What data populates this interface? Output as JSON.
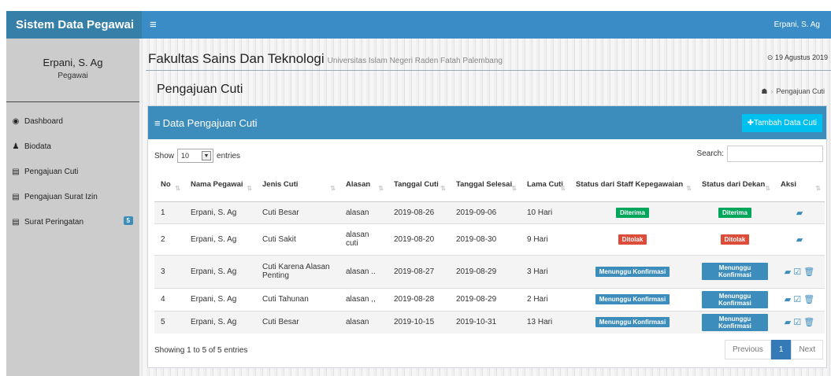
{
  "app": {
    "brand": "Sistem Data Pegawai",
    "user": "Erpani, S. Ag"
  },
  "sidebar": {
    "name": "Erpani, S. Ag",
    "role": "Pegawai",
    "items": [
      {
        "label": "Dashboard",
        "icon": "dashboard-icon"
      },
      {
        "label": "Biodata",
        "icon": "user-icon"
      },
      {
        "label": "Pengajuan Cuti",
        "icon": "card-icon"
      },
      {
        "label": "Pengajuan Surat Izin",
        "icon": "card-icon"
      },
      {
        "label": "Surat Peringatan",
        "icon": "card-icon",
        "badge": "5"
      }
    ]
  },
  "header": {
    "faculty": "Fakultas Sains Dan Teknologi",
    "university": "Universitas Islam Negeri Raden Fatah Palembang",
    "date": "⊙ 19 Agustus 2019"
  },
  "page": {
    "title": "Pengajuan Cuti",
    "breadcrumb_current": "Pengajuan Cuti"
  },
  "box": {
    "title": "Data Pengajuan Cuti",
    "add_button": "Tambah Data Cuti",
    "show_label": "Show",
    "entries_label": "entries",
    "page_length": "10",
    "search_label": "Search:",
    "search_value": ""
  },
  "table": {
    "columns": [
      "No",
      "Nama Pegawai",
      "Jenis Cuti",
      "Alasan",
      "Tanggal Cuti",
      "Tanggal Selesai",
      "Lama Cuti",
      "Status dari Staff Kepegawaian",
      "Status dari Dekan",
      "Aksi"
    ],
    "rows": [
      {
        "no": "1",
        "nama": "Erpani, S. Ag",
        "jenis": "Cuti Besar",
        "alasan": "alasan",
        "tgl": "2019-08-26",
        "selesai": "2019-09-06",
        "lama": "10 Hari",
        "staff": "Diterima",
        "staff_color": "g",
        "dekan": "Diterima",
        "dekan_color": "g",
        "aksi": "▰"
      },
      {
        "no": "2",
        "nama": "Erpani, S. Ag",
        "jenis": "Cuti Sakit",
        "alasan": "alasan cuti",
        "tgl": "2019-08-20",
        "selesai": "2019-08-30",
        "lama": "9 Hari",
        "staff": "Ditolak",
        "staff_color": "r",
        "dekan": "Ditolak",
        "dekan_color": "r",
        "aksi": "▰"
      },
      {
        "no": "3",
        "nama": "Erpani, S. Ag",
        "jenis": "Cuti Karena Alasan Penting",
        "alasan": "alasan ..",
        "tgl": "2019-08-27",
        "selesai": "2019-08-29",
        "lama": "3 Hari",
        "staff": "Menunggu Konfirmasi",
        "staff_color": "b",
        "dekan": "Menunggu Konfirmasi",
        "dekan_color": "b",
        "aksi": "▰ ☑ 🗑"
      },
      {
        "no": "4",
        "nama": "Erpani, S. Ag",
        "jenis": "Cuti Tahunan",
        "alasan": "alasan ,,",
        "tgl": "2019-08-28",
        "selesai": "2019-08-29",
        "lama": "2 Hari",
        "staff": "Menunggu Konfirmasi",
        "staff_color": "b",
        "dekan": "Menunggu Konfirmasi",
        "dekan_color": "b",
        "aksi": "▰ ☑ 🗑"
      },
      {
        "no": "5",
        "nama": "Erpani, S. Ag",
        "jenis": "Cuti Besar",
        "alasan": "alasan",
        "tgl": "2019-10-15",
        "selesai": "2019-10-31",
        "lama": "13 Hari",
        "staff": "Menunggu Konfirmasi",
        "staff_color": "b",
        "dekan": "Menunggu Konfirmasi",
        "dekan_color": "b",
        "aksi": "▰ ☑ 🗑"
      }
    ]
  },
  "footer": {
    "info": "Showing 1 to 5 of 5 entries",
    "prev": "Previous",
    "page": "1",
    "next": "Next"
  },
  "colors": {
    "navbar": "#3a8cc6",
    "brand": "#367fa9",
    "header": "#3c8dbc",
    "success": "#00a65a",
    "danger": "#dd4b39",
    "info": "#00c0ef"
  }
}
